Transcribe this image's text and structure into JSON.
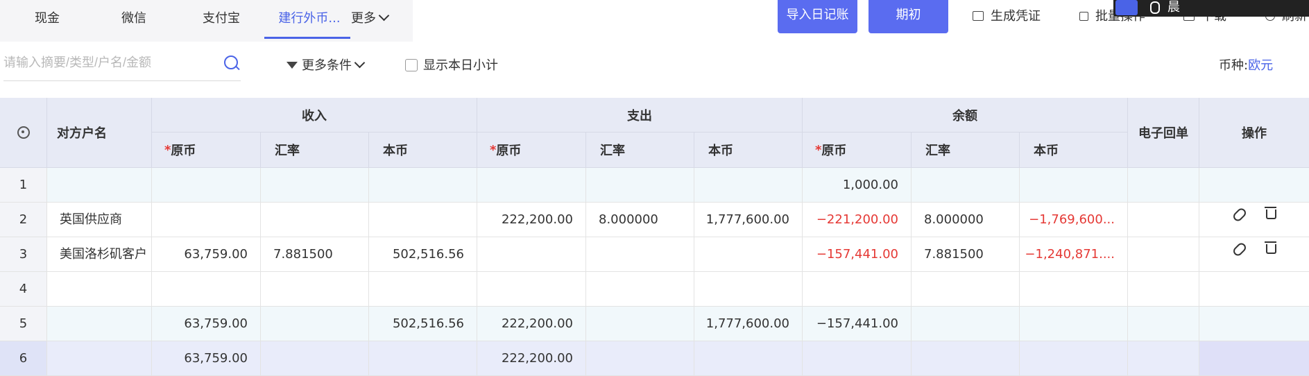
{
  "tabs": [
    {
      "label": "现金"
    },
    {
      "label": "微信"
    },
    {
      "label": "支付宝"
    },
    {
      "label": "建行外币..."
    }
  ],
  "more_tab": "更多",
  "toolbar": {
    "import_label": "导入日记账",
    "initial_label": "期初",
    "generate_voucher": "生成凭证",
    "batch_op": "批量操作",
    "download": "下载",
    "refresh": "刷新",
    "overlay_text": "晨"
  },
  "filter": {
    "search_placeholder": "请输入摘要/类型/户名/金额",
    "more_conditions": "更多条件",
    "show_daily_subtotal": "显示本日小计",
    "currency_label": "币种:",
    "currency_value": "欧元"
  },
  "table": {
    "headers": {
      "counterparty": "对方户名",
      "income": "收入",
      "expense": "支出",
      "balance": "余额",
      "receipt": "电子回单",
      "actions": "操作",
      "original": "原币",
      "rate": "汇率",
      "local": "本币",
      "required_mark": "*"
    },
    "rows": [
      {
        "idx": "1",
        "name": "",
        "in_orig": "",
        "in_rate": "",
        "in_local": "",
        "out_orig": "",
        "out_rate": "",
        "out_local": "",
        "bal_orig": "1,000.00",
        "bal_rate": "",
        "bal_local": "",
        "receipt": "",
        "has_ops": false
      },
      {
        "idx": "2",
        "name": "英国供应商",
        "in_orig": "",
        "in_rate": "",
        "in_local": "",
        "out_orig": "222,200.00",
        "out_rate": "8.000000",
        "out_local": "1,777,600.00",
        "bal_orig": "−221,200.00",
        "bal_rate": "8.000000",
        "bal_local": "−1,769,600...",
        "receipt": "",
        "has_ops": true
      },
      {
        "idx": "3",
        "name": "美国洛杉矶客户",
        "in_orig": "63,759.00",
        "in_rate": "7.881500",
        "in_local": "502,516.56",
        "out_orig": "",
        "out_rate": "",
        "out_local": "",
        "bal_orig": "−157,441.00",
        "bal_rate": "7.881500",
        "bal_local": "−1,240,871....",
        "receipt": "",
        "has_ops": true
      },
      {
        "idx": "4",
        "name": "",
        "in_orig": "",
        "in_rate": "",
        "in_local": "",
        "out_orig": "",
        "out_rate": "",
        "out_local": "",
        "bal_orig": "",
        "bal_rate": "",
        "bal_local": "",
        "receipt": "",
        "has_ops": false
      },
      {
        "idx": "5",
        "name": "",
        "in_orig": "63,759.00",
        "in_rate": "",
        "in_local": "502,516.56",
        "out_orig": "222,200.00",
        "out_rate": "",
        "out_local": "1,777,600.00",
        "bal_orig": "−157,441.00",
        "bal_rate": "",
        "bal_local": "",
        "receipt": "",
        "has_ops": false
      },
      {
        "idx": "6",
        "name": "",
        "in_orig": "63,759.00",
        "in_rate": "",
        "in_local": "",
        "out_orig": "222,200.00",
        "out_rate": "",
        "out_local": "",
        "bal_orig": "",
        "bal_rate": "",
        "bal_local": "",
        "receipt": "",
        "has_ops": false
      }
    ]
  },
  "colors": {
    "accent": "#4a63e7",
    "negative": "#e53935",
    "header_bg": "#e7eaf5",
    "summary_row_bg": "#f1f8fb",
    "selected_row_bg": "#e9ecfa"
  }
}
